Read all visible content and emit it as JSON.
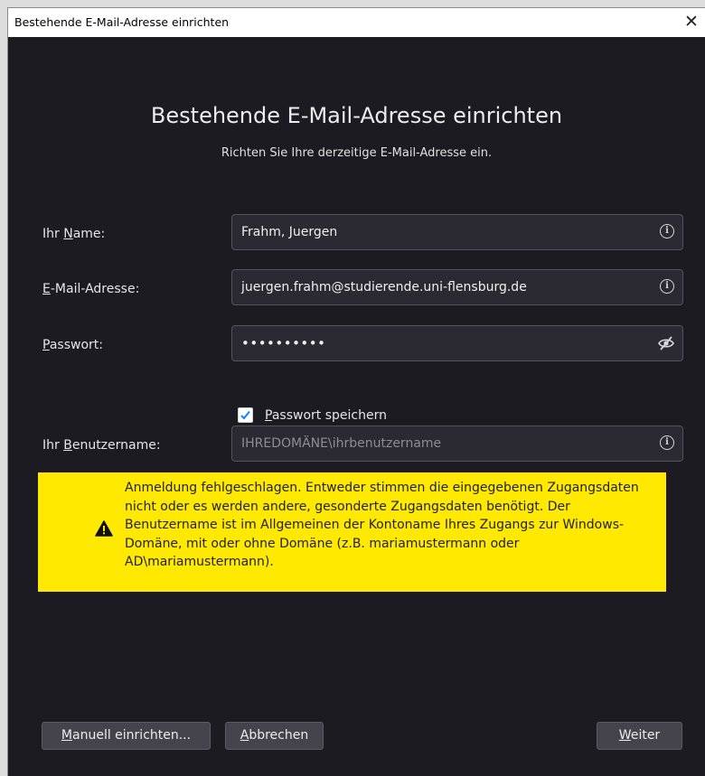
{
  "window": {
    "title": "Bestehende E-Mail-Adresse einrichten",
    "close_glyph": "✕"
  },
  "header": {
    "title": "Bestehende E-Mail-Adresse einrichten",
    "subtitle": "Richten Sie Ihre derzeitige E-Mail-Adresse ein."
  },
  "form": {
    "name": {
      "label_pre": "Ihr ",
      "label_key": "N",
      "label_post": "ame:",
      "value": "Frahm, Juergen"
    },
    "email": {
      "label_pre": "",
      "label_key": "E",
      "label_post": "-Mail-Adresse:",
      "value": "juergen.frahm@studierende.uni-flensburg.de"
    },
    "password": {
      "label_pre": "",
      "label_key": "P",
      "label_post": "asswort:",
      "value": "••••••••••"
    },
    "save_password": {
      "label_pre": "",
      "label_key": "P",
      "label_post": "asswort speichern",
      "checked": true
    },
    "username": {
      "label_pre": "Ihr ",
      "label_key": "B",
      "label_post": "enutzername:",
      "placeholder": "IHREDOMÄNE\\ihrbenutzername"
    },
    "info_glyph": "i"
  },
  "warning": {
    "text": "Anmeldung fehlgeschlagen. Entweder stimmen die eingegebenen Zugangsdaten nicht oder es werden andere, gesonderte Zugangsdaten benötigt. Der Benutzername ist im Allgemeinen der Kontoname Ihres Zugangs zur Windows-Domäne, mit oder ohne Domäne (z.B. mariamustermann oder AD\\mariamustermann).",
    "icon": "warning-triangle-icon",
    "background": "#ffe900"
  },
  "buttons": {
    "manual": {
      "key": "M",
      "rest": "anuell einrichten..."
    },
    "cancel": {
      "key": "A",
      "rest": "bbrechen"
    },
    "next": {
      "key": "W",
      "rest": "eiter"
    }
  },
  "colors": {
    "background": "#1c1b22",
    "field": "#2b2a33",
    "accent": "#0a84ff"
  }
}
